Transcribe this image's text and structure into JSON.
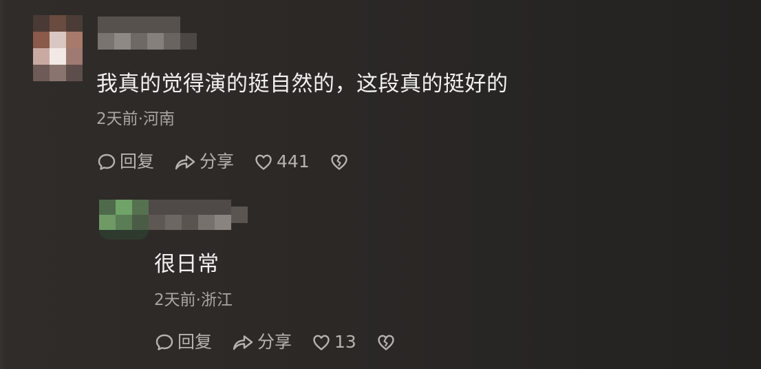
{
  "comments": [
    {
      "text": "我真的觉得演的挺自然的，这段真的挺好的",
      "time": "2天前",
      "location": "河南",
      "reply_label": "回复",
      "share_label": "分享",
      "like_count": "441",
      "meta_separator": "·"
    },
    {
      "text": "很日常",
      "time": "2天前",
      "location": "浙江",
      "reply_label": "回复",
      "share_label": "分享",
      "like_count": "13",
      "meta_separator": "·"
    }
  ],
  "colors": {
    "text_primary": "#f2f1ef",
    "text_secondary": "#a9a6a3",
    "icon": "#b6b3b0",
    "background": "#2a2725"
  },
  "icons": [
    "comment-bubble-icon",
    "share-arrow-icon",
    "heart-icon",
    "broken-heart-icon"
  ]
}
